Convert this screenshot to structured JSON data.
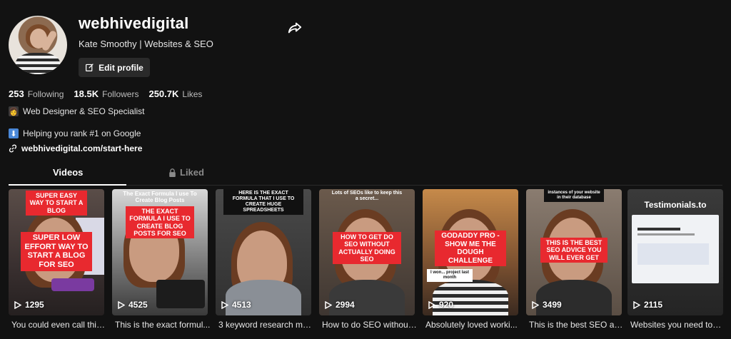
{
  "profile": {
    "username": "webhivedigital",
    "subtitle": "Kate Smoothy | Websites & SEO",
    "edit_label": "Edit profile",
    "stats": [
      {
        "value": "253",
        "label": "Following"
      },
      {
        "value": "18.5K",
        "label": "Followers"
      },
      {
        "value": "250.7K",
        "label": "Likes"
      }
    ],
    "bio_line1": "Web Designer & SEO Specialist",
    "bio_line2": "Helping you rank #1 on Google",
    "link": "webhivedigital.com/start-here"
  },
  "tabs": {
    "videos": "Videos",
    "liked": "Liked"
  },
  "videos": [
    {
      "overlay_top": "SUPER EASY WAY TO START A BLOG",
      "overlay_main": "SUPER LOW EFFORT WAY TO START A BLOG FOR SEO",
      "views": "1295",
      "desc": "You could even call this..."
    },
    {
      "overlay_top": "The Exact Formula I use To Create Blog Posts",
      "overlay_main": "THE EXACT FORMULA I USE TO CREATE BLOG POSTS FOR SEO",
      "views": "4525",
      "desc": "This is the exact formul..."
    },
    {
      "overlay_top": "HERE IS THE EXACT FORMULA THAT I USE TO CREATE HUGE SPREADSHEETS",
      "overlay_main": "",
      "views": "4513",
      "desc": "3 keyword research me..."
    },
    {
      "overlay_top": "Lots of SEOs like to keep this a secret...",
      "overlay_main": "HOW TO GET DO SEO WITHOUT ACTUALLY DOING SEO",
      "views": "2994",
      "desc": "How to do SEO without..."
    },
    {
      "overlay_top": "",
      "overlay_main": "GODADDY PRO - SHOW ME THE DOUGH CHALLENGE",
      "overlay_small": "I won... project last month",
      "views": "920",
      "desc": "Absolutely loved worki..."
    },
    {
      "overlay_top": "instances of your website in their database",
      "overlay_main": "THIS IS THE BEST SEO ADVICE YOU WILL EVER GET",
      "views": "3499",
      "desc": "This is the best SEO ad..."
    },
    {
      "overlay_top": "Testimonials.to",
      "overlay_main": "",
      "views": "2115",
      "desc": "Websites you need to k..."
    }
  ],
  "colors": {
    "accent_red": "#e8292f",
    "background": "#121212"
  }
}
